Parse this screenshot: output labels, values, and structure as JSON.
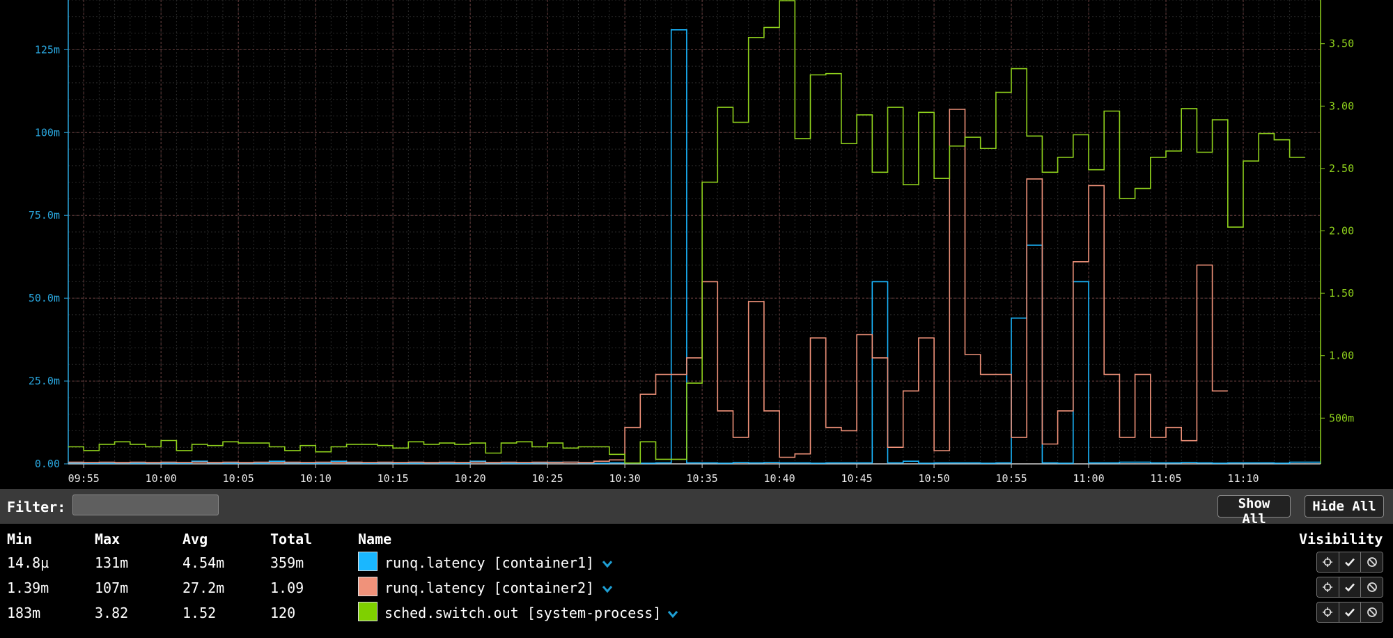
{
  "chart_data": {
    "type": "line",
    "title": "",
    "x_ticks": [
      "09:55",
      "10:00",
      "10:05",
      "10:10",
      "10:15",
      "10:20",
      "10:25",
      "10:30",
      "10:35",
      "10:40",
      "10:45",
      "10:50",
      "10:55",
      "11:00",
      "11:05",
      "11:10"
    ],
    "x_range_minutes": [
      -1,
      80
    ],
    "bucket_minutes": 1,
    "grid": true,
    "y_left": {
      "range": [
        0,
        140
      ],
      "unit_scale": "milli",
      "ticks": [
        0,
        25,
        50,
        75,
        100,
        125
      ],
      "tick_labels": [
        "0.00",
        "25.0m",
        "50.0m",
        "75.0m",
        "100m",
        "125m"
      ]
    },
    "y_right": {
      "range": [
        0.1333,
        3.85
      ],
      "ticks": [
        0.5,
        1.0,
        1.5,
        2.0,
        2.5,
        3.0,
        3.5
      ],
      "tick_labels": [
        "500m",
        "1.00",
        "1.50",
        "2.00",
        "2.50",
        "3.00",
        "3.50"
      ]
    },
    "series": [
      {
        "name": "runq.latency [container1]",
        "axis": "left",
        "color": "#1ab7ff",
        "values": [
          0.3,
          0.2,
          0.2,
          0.3,
          0.2,
          0.3,
          0.2,
          0.2,
          0.8,
          0.3,
          0.2,
          0.3,
          0.2,
          0.8,
          0.3,
          0.2,
          0.2,
          0.8,
          0.3,
          0.2,
          0.3,
          0.2,
          0.2,
          0.3,
          0.2,
          0.2,
          0.8,
          0.3,
          0.2,
          0.2,
          0.3,
          0.5,
          0.5,
          0.3,
          0.2,
          0.3,
          0.2,
          0.2,
          0.3,
          131,
          0.3,
          0.3,
          0.2,
          0.4,
          0.3,
          0.4,
          0.3,
          0.3,
          0.2,
          0.3,
          0.3,
          0.3,
          55,
          0.3,
          0.8,
          0.2,
          0.3,
          0.3,
          0.3,
          0.2,
          0.3,
          44,
          66,
          0.3,
          0.2,
          55,
          0.3,
          0.3,
          0.5,
          0.5,
          0.3,
          0.3,
          0.4,
          0.3,
          0.2,
          0.3,
          0.3,
          0.3,
          0.2,
          0.5,
          0.5
        ]
      },
      {
        "name": "runq.latency [container2]",
        "axis": "left",
        "color": "#f0927a",
        "values": [
          0.5,
          0.4,
          0.5,
          0.4,
          0.5,
          0.4,
          0.5,
          0.4,
          0.5,
          0.4,
          0.5,
          0.4,
          0.5,
          0.4,
          0.5,
          0.4,
          0.5,
          0.4,
          0.5,
          0.4,
          0.5,
          0.4,
          0.5,
          0.4,
          0.5,
          0.4,
          0.5,
          0.4,
          0.5,
          0.4,
          0.5,
          0.4,
          0.5,
          0.4,
          0.8,
          1.2,
          11,
          21,
          27,
          27,
          32,
          55,
          16,
          8,
          49,
          16,
          2,
          3,
          38,
          11,
          10,
          39,
          32,
          5,
          22,
          38,
          4,
          107,
          33,
          27,
          27,
          8,
          86,
          6,
          16,
          61,
          84,
          27,
          8,
          27,
          8,
          11,
          7,
          60,
          22
        ]
      },
      {
        "name": "sched.switch.out [system-process]",
        "axis": "right",
        "color": "#8fd11c",
        "values": [
          0.27,
          0.24,
          0.29,
          0.31,
          0.29,
          0.27,
          0.32,
          0.24,
          0.29,
          0.28,
          0.31,
          0.3,
          0.3,
          0.27,
          0.24,
          0.28,
          0.23,
          0.27,
          0.29,
          0.29,
          0.28,
          0.26,
          0.31,
          0.29,
          0.3,
          0.29,
          0.3,
          0.22,
          0.3,
          0.31,
          0.27,
          0.3,
          0.26,
          0.27,
          0.27,
          0.21,
          0.14,
          0.31,
          0.17,
          0.17,
          0.78,
          2.39,
          2.99,
          2.87,
          3.55,
          3.63,
          3.85,
          2.74,
          3.25,
          3.26,
          2.7,
          2.93,
          2.47,
          2.99,
          2.37,
          2.95,
          2.42,
          2.68,
          2.75,
          2.66,
          3.11,
          3.3,
          2.76,
          2.47,
          2.59,
          2.77,
          2.49,
          2.96,
          2.26,
          2.34,
          2.59,
          2.64,
          2.98,
          2.63,
          2.89,
          2.03,
          2.56,
          2.78,
          2.73,
          2.59
        ]
      }
    ]
  },
  "filter": {
    "label": "Filter:",
    "value": "",
    "placeholder": ""
  },
  "buttons": {
    "show_all": "Show All",
    "hide_all": "Hide All"
  },
  "legend": {
    "headers": {
      "min": "Min",
      "max": "Max",
      "avg": "Avg",
      "total": "Total",
      "name": "Name",
      "visibility": "Visibility"
    },
    "rows": [
      {
        "min": "14.8µ",
        "max": "131m",
        "avg": "4.54m",
        "total": "359m",
        "name": "runq.latency [container1]",
        "color": "#1ab7ff"
      },
      {
        "min": "1.39m",
        "max": "107m",
        "avg": "27.2m",
        "total": "1.09",
        "name": "runq.latency [container2]",
        "color": "#f0927a"
      },
      {
        "min": "183m",
        "max": "3.82",
        "avg": "1.52",
        "total": "120",
        "name": "sched.switch.out [system-process]",
        "color": "#7fd000"
      }
    ],
    "row_icons": {
      "dropdown": "chevron-down-icon",
      "focus": "crosshair-icon",
      "show": "check-icon",
      "hide": "ban-icon"
    }
  }
}
